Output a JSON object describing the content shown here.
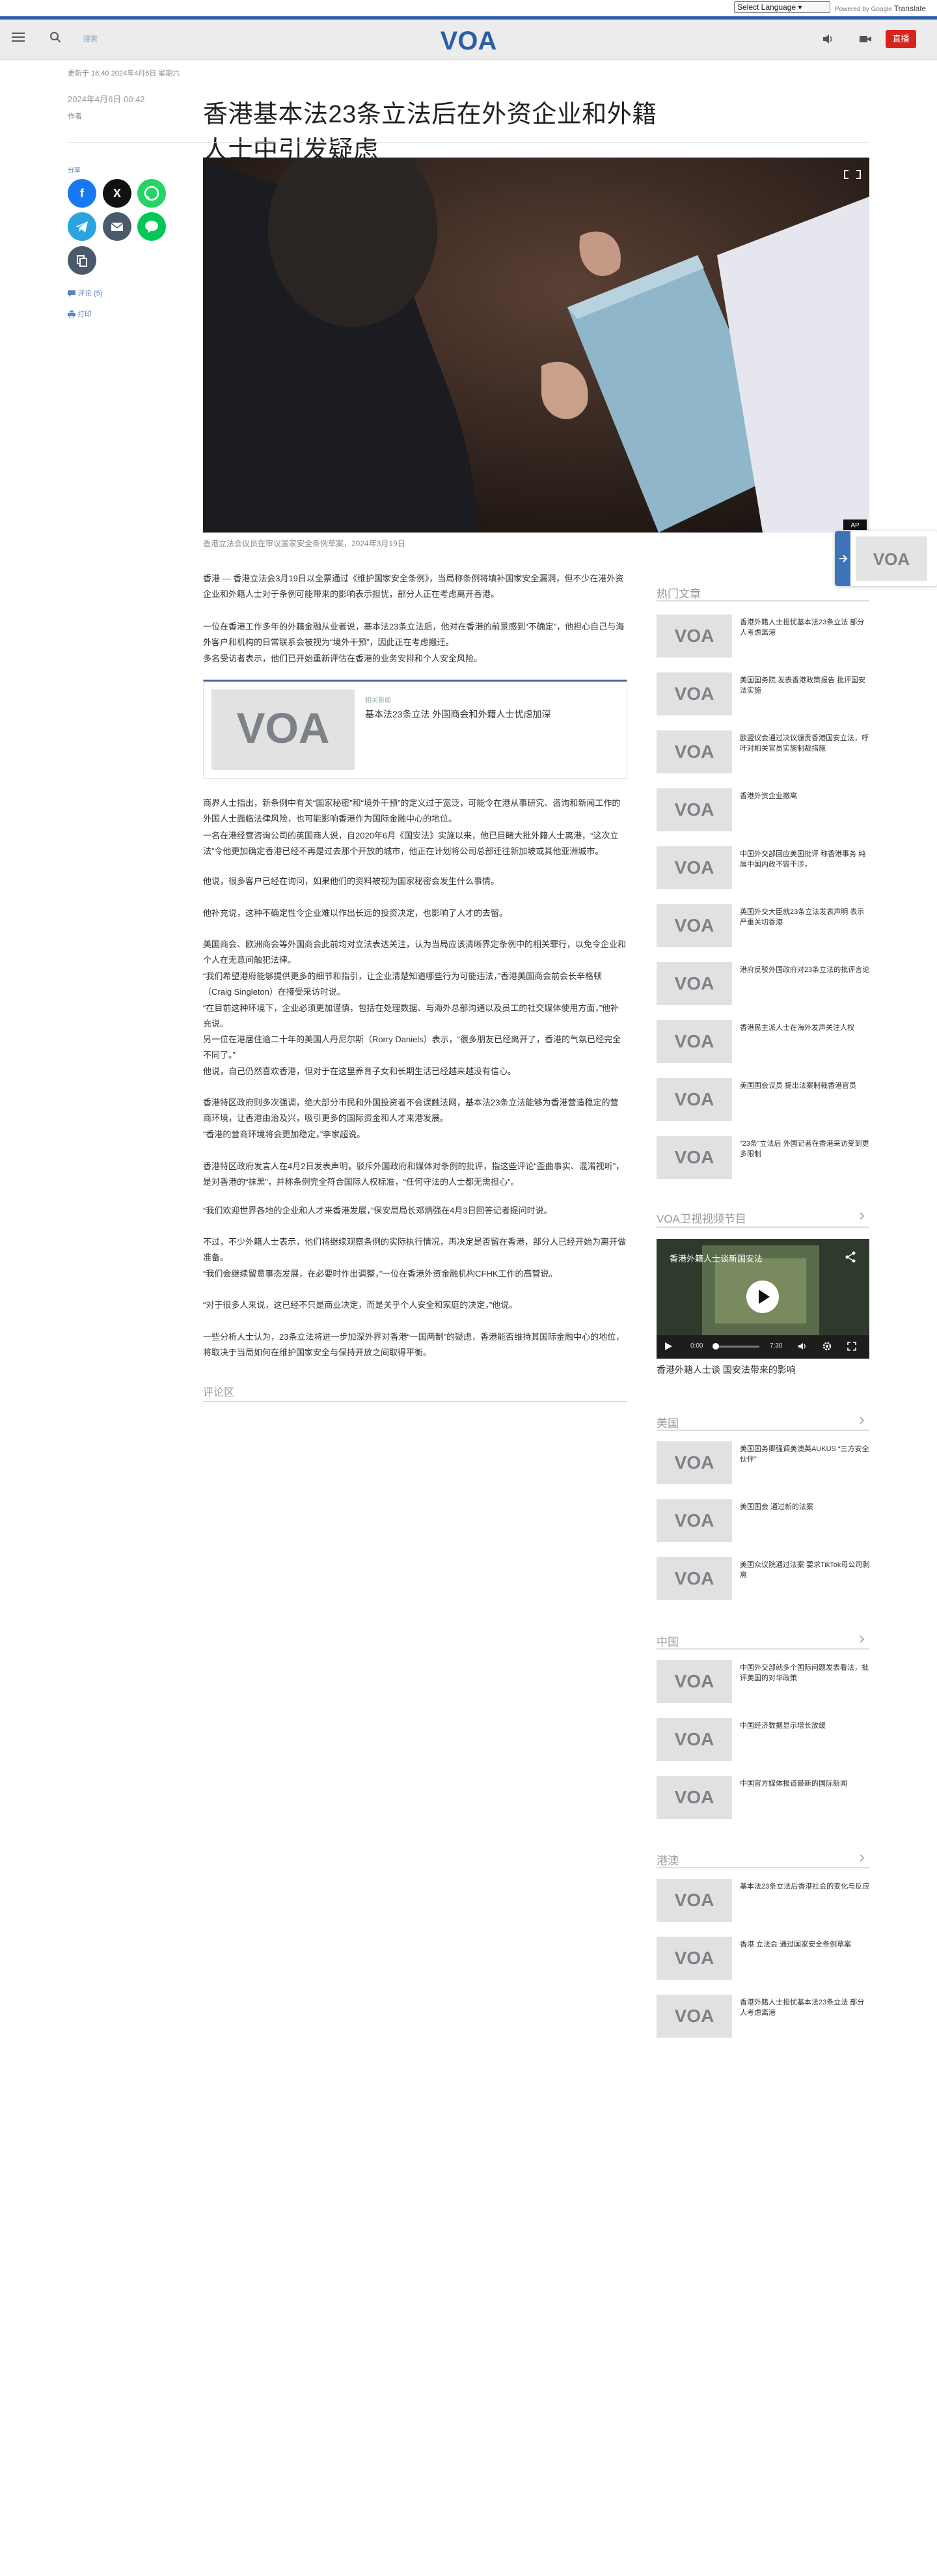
{
  "translate": {
    "select_label": "Select Language",
    "powered_by": "Powered by",
    "google": "Google",
    "translate": "Translate"
  },
  "header": {
    "small_label": "搜索",
    "live_label": "直播"
  },
  "article": {
    "meta_updated": "更新于 16:40 2024年4月6日 星期六",
    "date": "2024年4月6日 00:42",
    "author": "作者",
    "title": "香港基本法23条立法后在外资企业和外籍人士中引发疑虑",
    "caption": "香港立法会议员在审议国家安全条例草案，2024年3月19日",
    "paragraphs": [
      "香港 — 香港立法会3月19日以全票通过《维护国家安全条例》，当局称条例将填补国家安全漏洞，但不少在港外资企业和外籍人士对于条例可能带来的影响表示担忧，部分人正在考虑离开香港。",
      "一位在香港工作多年的外籍金融从业者说，基本法23条立法后，他对在香港的前景感到“不确定”，他担心自己与海外客户和机构的日常联系会被视为“境外干预”，因此正在考虑搬迁。",
      "多名受访者表示，他们已开始重新评估在香港的业务安排和个人安全风险。",
      "商界人士指出，新条例中有关“国家秘密”和“境外干预”的定义过于宽泛，可能令在港从事研究、咨询和新闻工作的外国人士面临法律风险，也可能影响香港作为国际金融中心的地位。",
      "一名在港经营咨询公司的英国商人说，自2020年6月《国安法》实施以来，他已目睹大批外籍人士离港，“这次立法”令他更加确定香港已经不再是过去那个开放的城市，他正在计划将公司总部迁往新加坡或其他亚洲城市。",
      "他说，很多客户已经在询问，如果他们的资料被视为国家秘密会发生什么事情。",
      "他补充说，这种不确定性令企业难以作出长远的投资决定，也影响了人才的去留。",
      "美国商会、欧洲商会等外国商会此前均对立法表达关注，认为当局应该清晰界定条例中的相关罪行，以免令企业和个人在无意间触犯法律。",
      "“我们希望港府能够提供更多的细节和指引，让企业清楚知道哪些行为可能违法，”香港美国商会前会长辛格顿（Craig Singleton）在接受采访时说。",
      "“在目前这种环境下，企业必须更加谨慎，包括在处理数据、与海外总部沟通以及员工的社交媒体使用方面，”他补充说。",
      "另一位在港居住逾二十年的美国人丹尼尔斯（Rorry Daniels）表示，“很多朋友已经离开了，香港的气氛已经完全不同了。”",
      "他说，自己仍然喜欢香港，但对于在这里养育子女和长期生活已经越来越没有信心。",
      "香港特区政府则多次强调，绝大部分市民和外国投资者不会误触法网，基本法23条立法能够为香港营造稳定的营商环境，让香港由治及兴，吸引更多的国际资金和人才来港发展。",
      "“香港的营商环境将会更加稳定，”李家超说。",
      "香港特区政府发言人在4月2日发表声明，驳斥外国政府和媒体对条例的批评，指这些评论“歪曲事实、混淆视听”，是对香港的“抹黑”，并称条例完全符合国际人权标准，“任何守法的人士都无需担心”。",
      "“我们欢迎世界各地的企业和人才来香港发展，”保安局局长邓炳强在4月3日回答记者提问时说。",
      "不过，不少外籍人士表示，他们将继续观察条例的实际执行情况，再决定是否留在香港，部分人已经开始为离开做准备。",
      "“我们会继续留意事态发展，在必要时作出调整，”一位在香港外资金融机构CFHK工作的高管说。",
      "“对于很多人来说，这已经不只是商业决定，而是关乎个人安全和家庭的决定，”他说。",
      "一些分析人士认为，23条立法将进一步加深外界对香港“一国两制”的疑虑，香港能否维持其国际金融中心的地位，将取决于当局如何在维护国家安全与保持开放之间取得平衡。"
    ],
    "related": {
      "kicker": "相关新闻",
      "title": "基本法23条立法 外国商会和外籍人士忧虑加深"
    },
    "comments_head": "评论区"
  },
  "share": {
    "label": "分享",
    "comments_link": "评论 (5)",
    "print_link": "打印"
  },
  "sidebar": {
    "popular_title": "热门文章",
    "popular": [
      "香港外籍人士担忧基本法23条立法 部分人考虑离港",
      "美国国务院 发表香港政策报告 批评国安法实施",
      "欧盟议会通过决议谴责香港国安立法，呼吁对相关官员实施制裁措施",
      "香港外资企业撤离",
      "中国外交部回应美国批评 称香港事务 纯属中国内政不容干涉，",
      "英国外交大臣就23条立法发表声明 表示严重关切香港",
      "港府反驳外国政府对23条立法的批评言论",
      "香港民主派人士在海外发声关注人权",
      "美国国会议员 提出法案制裁香港官员",
      "“23条”立法后 外国记者在香港采访受到更多限制"
    ],
    "video_title": "VOA卫视视频节目",
    "video_overlay": "香港外籍人士谈新国安法",
    "video_caption": "香港外籍人士谈 国安法带来的影响",
    "video_current": "0:00",
    "video_duration": "7:30",
    "sec2_title": "美国",
    "sec2": [
      "美国国务卿强调美澳英AUKUS “三方安全伙伴”",
      "美国国会 通过新的法案",
      "美国众议院通过法案 要求TikTok母公司剥离"
    ],
    "sec3_title": "中国",
    "sec3": [
      "中国外交部就多个国际问题发表看法，批评美国的对华政策",
      "中国经济数据显示增长放缓",
      "中国官方媒体报道最新的国际新闻"
    ],
    "sec4_title": "港澳",
    "sec4": [
      "基本法23条立法后香港社会的变化与反应",
      "香港 立法会 通过国家安全条例草案",
      "香港外籍人士担忧基本法23条立法 部分人考虑离港"
    ]
  },
  "colors": {
    "brand_blue": "#2a5fa8",
    "live_red": "#d9241b",
    "facebook": "#1877f2",
    "x": "#111111",
    "whatsapp": "#25d366",
    "telegram": "#2aa3de",
    "email": "#4a5a6a",
    "line": "#06c755"
  }
}
